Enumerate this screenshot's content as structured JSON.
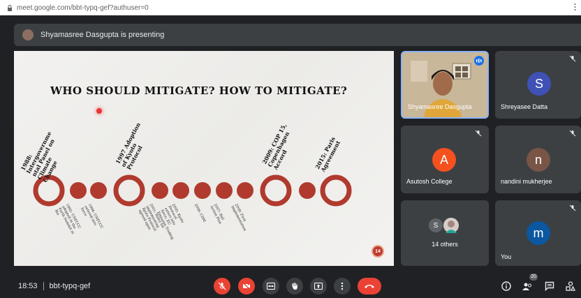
{
  "browser": {
    "url": "meet.google.com/bbt-typq-gef?authuser=0"
  },
  "presenting_banner": {
    "text": "Shyamasree Dasgupta is presenting"
  },
  "slide": {
    "title": "WHO SHOULD MITIGATE? HOW TO MITIGATE?",
    "page_number": "14",
    "milestones_big": [
      "1988:\nIntergovernme\nntal Panel on\nClimate\nChange",
      "1997 Adoption\nof Kyoto\nProtocol",
      "2009: COP 15,\nCopenhagen\nAccord",
      "2015: Paris\nAgreement"
    ],
    "milestones_small": [
      "1992: UNFCCC\nadopted in the\nEarth Summit in\nRio",
      "1994: UNFCCC\nentered into\nforce",
      "2001: Rules for\nimplementing\nKyoto Protocol\nagreed upon",
      "2005: Kyoto\nProtocol\nenters into\nforce; EU\nEmission Trading",
      "2006: CDM",
      "2007: Bali\nAction Plan",
      "2008: First\nImplementation"
    ]
  },
  "participants": [
    {
      "name": "Shyamasree Dasgupta",
      "speaking": true
    },
    {
      "name": "Shreyasee Datta",
      "initial": "S",
      "color": "#3f51b5"
    },
    {
      "name": "Asutosh College",
      "initial": "A",
      "color": "#f4511e"
    },
    {
      "name": "nandini mukherjee",
      "initial": "n",
      "color": "#795548"
    },
    {
      "name": "14 others",
      "initial": "S",
      "color": "#5f6368"
    },
    {
      "name": "You",
      "initial": "m",
      "color": "#0b57a0"
    }
  ],
  "bottom": {
    "time": "18:53",
    "meeting_code": "bbt-typq-gef",
    "people_count": "20"
  },
  "colors": {
    "red": "#ea4335",
    "timeline": "#b03a2e"
  }
}
